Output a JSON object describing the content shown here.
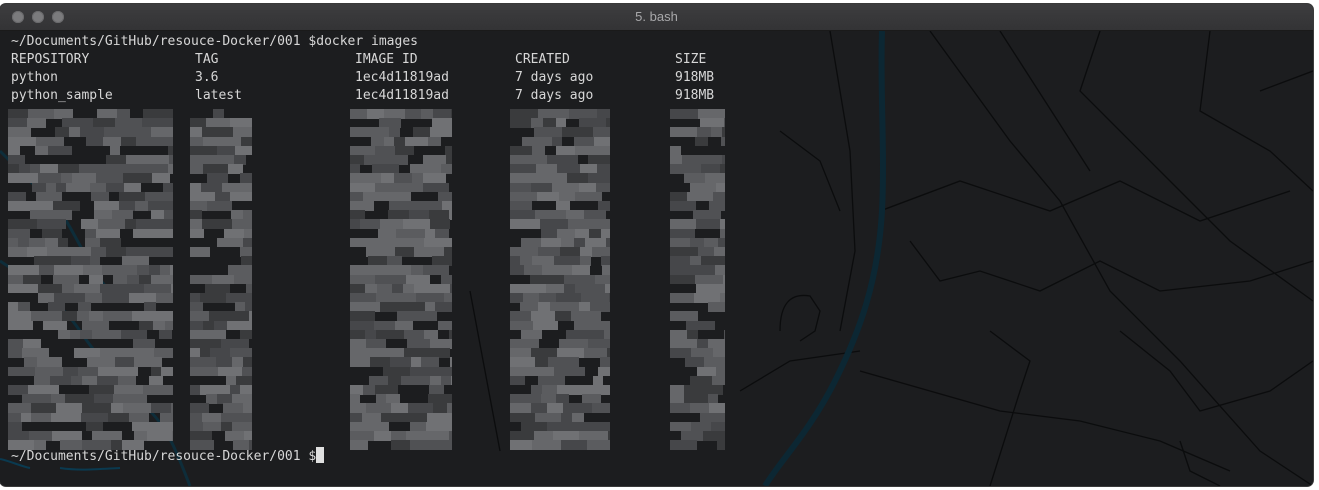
{
  "window": {
    "title": "5. bash"
  },
  "terminal": {
    "command_line": "~/Documents/GitHub/resouce-Docker/001 $docker images",
    "table": {
      "headers": [
        "REPOSITORY",
        "TAG",
        "IMAGE ID",
        "CREATED",
        "SIZE"
      ],
      "rows": [
        [
          "python",
          "3.6",
          "1ec4d11819ad",
          "7 days ago",
          "918MB"
        ],
        [
          "python_sample",
          "latest",
          "1ec4d11819ad",
          "7 days ago",
          "918MB"
        ]
      ]
    },
    "prompt": "~/Documents/GitHub/resouce-Docker/001 $"
  },
  "colors": {
    "terminal_background": "#1c1d1f",
    "text": "#d7d7d7",
    "map_lines": "#0b0c0d",
    "river": "#0c2733"
  }
}
